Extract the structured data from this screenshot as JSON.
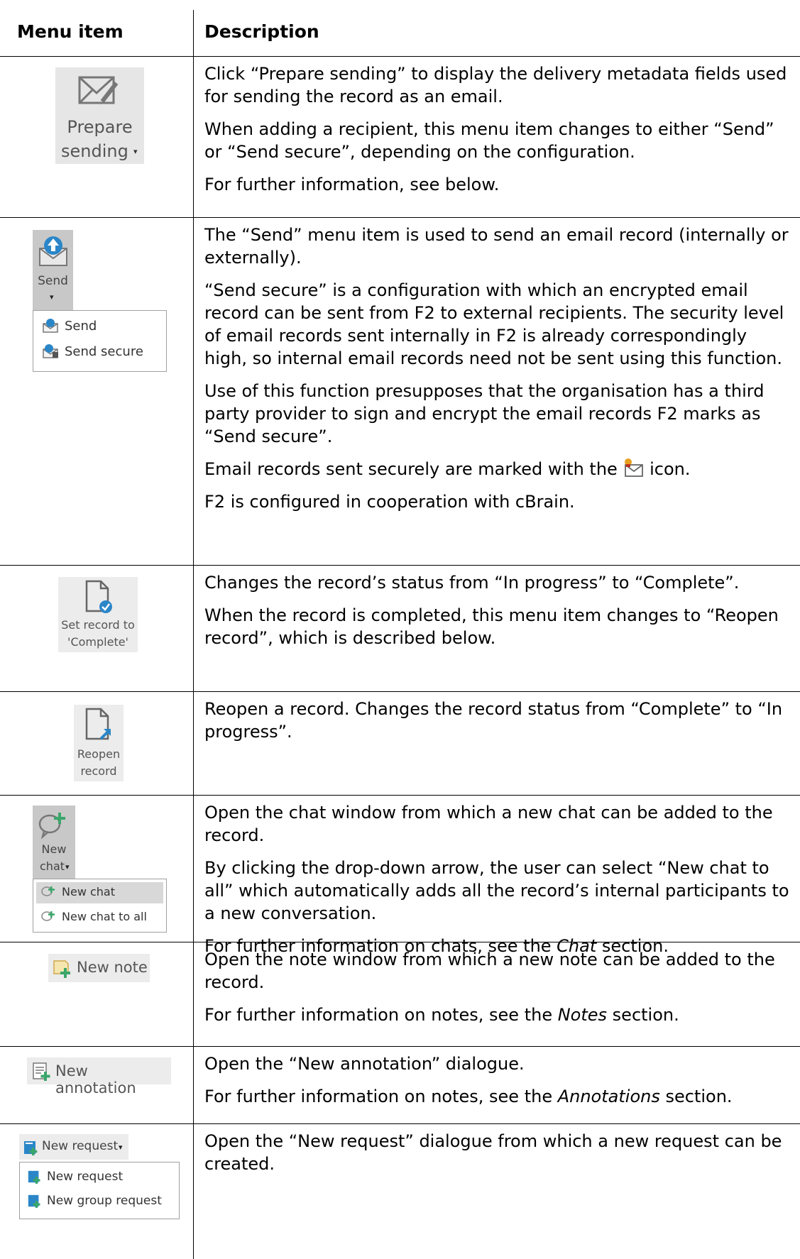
{
  "header": {
    "col1": "Menu item",
    "col2": "Description"
  },
  "rows": [
    {
      "button": {
        "line1": "Prepare",
        "line2": "sending",
        "caret": "▾",
        "icon": "envelope-pen-icon"
      },
      "paras": [
        "Click “Prepare sending” to display the delivery metadata fields used for sending the record as an email.",
        "When adding a recipient, this menu item changes to either “Send” or “Send secure”, depending on the configuration.",
        "For further information, see below."
      ]
    },
    {
      "button": {
        "label": "Send",
        "caret": "▾",
        "icon": "envelope-upload-icon"
      },
      "menu": [
        "Send",
        "Send secure"
      ],
      "paras": [
        "The “Send” menu item is used to send an email record (internally or externally).",
        "“Send secure” is a configuration with which an encrypted email record can be sent from F2 to external recipients. The security level of email records sent internally in F2 is already correspondingly high, so internal email records need not be sent using this function.",
        "Use of this function presupposes that the organisation has a third party provider to sign and encrypt the email records F2 marks as “Send secure”.",
        "F2 is configured in cooperation with cBrain."
      ],
      "icon_para": {
        "before": "Email records sent securely are marked with the ",
        "after": " icon.",
        "icon": "secure-envelope-icon"
      }
    },
    {
      "button": {
        "line1": "Set record to",
        "line2": "'Complete'",
        "icon": "document-check-icon"
      },
      "paras": [
        "Changes the record’s status from “In progress” to “Complete”.",
        "When the record is completed, this menu item changes to “Reopen record”, which is described below."
      ]
    },
    {
      "button": {
        "line1": "Reopen",
        "line2": "record",
        "icon": "document-arrow-icon"
      },
      "paras": [
        "Reopen a record. Changes the record status from “Complete” to “In progress”."
      ]
    },
    {
      "button": {
        "line1": "New",
        "line2": "chat",
        "caret": "▾",
        "icon": "chat-plus-icon"
      },
      "menu": [
        "New chat",
        "New chat to all"
      ],
      "paras": [
        "Open the chat window from which a new chat can be added to the record.",
        "By clicking the drop-down arrow, the user can select “New chat to all” which automatically adds all the record’s internal participants to a new conversation."
      ],
      "ref": {
        "before": "For further information on chats, see the ",
        "em": "Chat",
        "after": " section."
      }
    },
    {
      "button": {
        "label": "New note",
        "icon": "note-plus-icon"
      },
      "paras": [
        "Open the note window from which a new note can be added to the record."
      ],
      "ref": {
        "before": "For further information on notes, see the ",
        "em": "Notes",
        "after": " section."
      }
    },
    {
      "button": {
        "label": "New annotation",
        "icon": "annotation-icon"
      },
      "paras": [
        "Open the “New annotation” dialogue."
      ],
      "ref": {
        "before": "For further information on notes, see the ",
        "em": "Annotations",
        "after": " section."
      }
    },
    {
      "button": {
        "label": "New request",
        "caret": "▾",
        "icon": "request-icon"
      },
      "menu": [
        "New request",
        "New group request"
      ],
      "paras": [
        "Open the “New request” dialogue from which a new request can be created."
      ]
    }
  ]
}
